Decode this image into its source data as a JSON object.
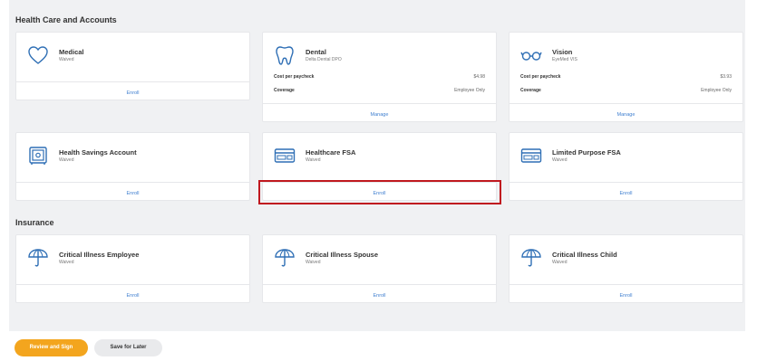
{
  "colors": {
    "accent_link": "#3f7fd0",
    "primary_button": "#f3a51e",
    "highlight_border": "#c0181f",
    "panel_bg": "#f0f1f3"
  },
  "sections": {
    "health": "Health Care and Accounts",
    "insurance": "Insurance"
  },
  "cards": {
    "medical": {
      "name": "Medical",
      "sub": "Waived",
      "action": "Enroll",
      "icon": "heart-icon"
    },
    "dental": {
      "name": "Dental",
      "sub": "Delta Dental DPO",
      "action": "Manage",
      "icon": "tooth-icon",
      "cost_label": "Cost per paycheck",
      "cost_value": "$4.98",
      "coverage_label": "Coverage",
      "coverage_value": "Employee Only"
    },
    "vision": {
      "name": "Vision",
      "sub": "EyeMed VIS",
      "action": "Manage",
      "icon": "glasses-icon",
      "cost_label": "Cost per paycheck",
      "cost_value": "$3.93",
      "coverage_label": "Coverage",
      "coverage_value": "Employee Only"
    },
    "hsa": {
      "name": "Health Savings Account",
      "sub": "Waived",
      "action": "Enroll",
      "icon": "safe-icon"
    },
    "hfsa": {
      "name": "Healthcare FSA",
      "sub": "Waived",
      "action": "Enroll",
      "icon": "credit-card-icon"
    },
    "lpfsa": {
      "name": "Limited Purpose FSA",
      "sub": "Waived",
      "action": "Enroll",
      "icon": "credit-card-icon"
    },
    "ci_employee": {
      "name": "Critical Illness Employee",
      "sub": "Waived",
      "action": "Enroll",
      "icon": "umbrella-icon"
    },
    "ci_spouse": {
      "name": "Critical Illness Spouse",
      "sub": "Waived",
      "action": "Enroll",
      "icon": "umbrella-icon"
    },
    "ci_child": {
      "name": "Critical Illness Child",
      "sub": "Waived",
      "action": "Enroll",
      "icon": "umbrella-icon"
    }
  },
  "actions": {
    "review": "Review and Sign",
    "save": "Save for Later"
  }
}
